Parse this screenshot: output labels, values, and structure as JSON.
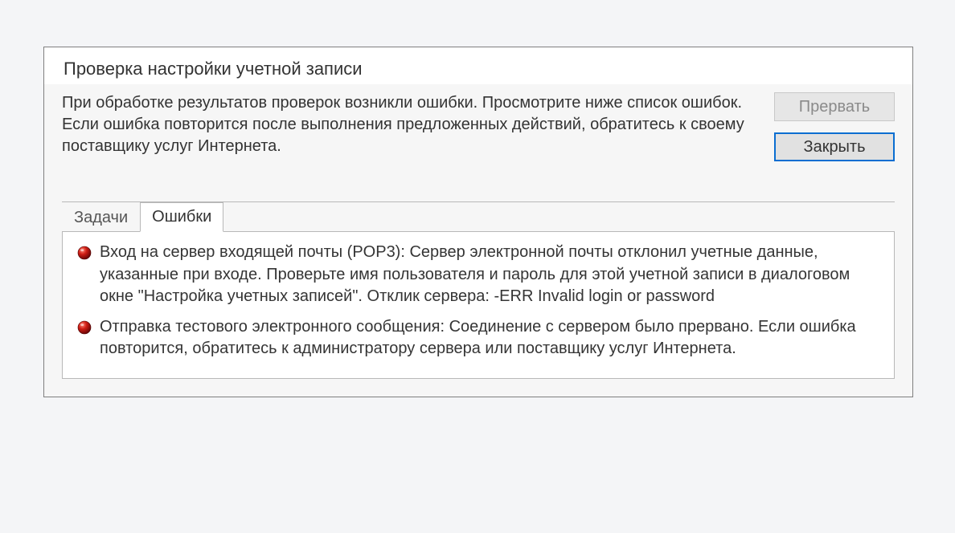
{
  "dialog": {
    "title": "Проверка настройки учетной записи",
    "message": "При обработке результатов проверок возникли ошибки. Просмотрите ниже список ошибок. Если ошибка повторится после выполнения предложенных действий, обратитесь к своему поставщику услуг Интернета.",
    "buttons": {
      "abort": "Прервать",
      "close": "Закрыть"
    },
    "tabs": {
      "tasks": "Задачи",
      "errors": "Ошибки"
    },
    "errors": [
      "Вход на сервер входящей почты (POP3): Сервер электронной почты отклонил учетные данные, указанные при входе. Проверьте имя пользователя и пароль для этой учетной записи в диалоговом окне \"Настройка учетных записей\".  Отклик сервера: -ERR Invalid login or password",
      "Отправка тестового электронного сообщения: Соединение с сервером было прервано. Если ошибка повторится, обратитесь к администратору сервера или поставщику услуг Интернета."
    ]
  }
}
